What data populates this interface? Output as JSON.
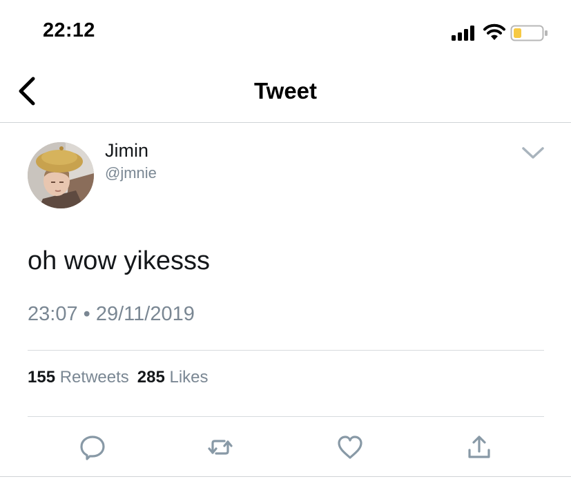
{
  "status_bar": {
    "time": "22:12",
    "icons": [
      "signal-icon",
      "wifi-icon",
      "battery-icon"
    ],
    "battery_level": 0.25,
    "battery_color": "#f6c944"
  },
  "nav": {
    "back_icon": "chevron-left-icon",
    "title": "Tweet"
  },
  "tweet": {
    "author": {
      "name": "Jimin",
      "handle": "@jmnie",
      "avatar": "avatar-photo"
    },
    "menu_icon": "chevron-down-icon",
    "text": "oh wow yikesss",
    "timestamp": "23:07 • 29/11/2019",
    "stats": {
      "retweets_count": "155",
      "retweets_label": "Retweets",
      "likes_count": "285",
      "likes_label": "Likes"
    },
    "actions": [
      "reply-icon",
      "retweet-icon",
      "like-icon",
      "share-icon"
    ]
  },
  "colors": {
    "text_primary": "#14171a",
    "text_secondary": "#7a8793",
    "icon_gray": "#8899a6",
    "divider": "#d6dadd"
  }
}
